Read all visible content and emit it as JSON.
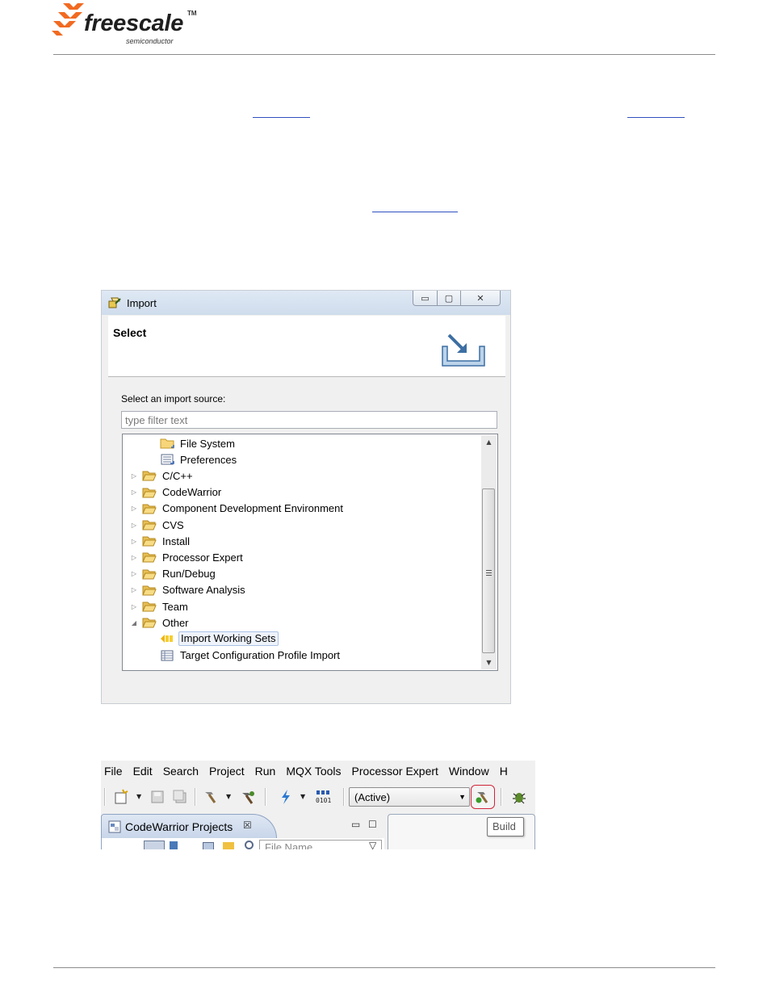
{
  "header": {
    "brand": "freescale",
    "trademark": "TM",
    "subbrand": "semiconductor"
  },
  "colors": {
    "brand_orange": "#f26a21",
    "link_blue": "#3050c0",
    "rule_gray": "#8c8c8c",
    "highlight_red": "#d0243a"
  },
  "import_dialog": {
    "title": "Import",
    "window_buttons": {
      "minimize": "▭",
      "maximize": "▢",
      "close": "✕"
    },
    "banner_title": "Select",
    "source_label": "Select an import source:",
    "filter_placeholder": "type filter text",
    "tree": [
      {
        "label": "File System",
        "icon": "folder-icon",
        "level": 1,
        "expander": ""
      },
      {
        "label": "Preferences",
        "icon": "preferences-icon",
        "level": 1,
        "expander": ""
      },
      {
        "label": "C/C++",
        "icon": "folder-open-icon",
        "level": 0,
        "expander": "▷"
      },
      {
        "label": "CodeWarrior",
        "icon": "folder-open-icon",
        "level": 0,
        "expander": "▷"
      },
      {
        "label": "Component Development Environment",
        "icon": "folder-open-icon",
        "level": 0,
        "expander": "▷"
      },
      {
        "label": "CVS",
        "icon": "folder-open-icon",
        "level": 0,
        "expander": "▷"
      },
      {
        "label": "Install",
        "icon": "folder-open-icon",
        "level": 0,
        "expander": "▷"
      },
      {
        "label": "Processor Expert",
        "icon": "folder-open-icon",
        "level": 0,
        "expander": "▷"
      },
      {
        "label": "Run/Debug",
        "icon": "folder-open-icon",
        "level": 0,
        "expander": "▷"
      },
      {
        "label": "Software Analysis",
        "icon": "folder-open-icon",
        "level": 0,
        "expander": "▷"
      },
      {
        "label": "Team",
        "icon": "folder-open-icon",
        "level": 0,
        "expander": "▷"
      },
      {
        "label": "Other",
        "icon": "folder-open-icon",
        "level": 0,
        "expander": "◢"
      },
      {
        "label": "Import Working Sets",
        "icon": "working-sets-icon",
        "level": 1,
        "expander": "",
        "selected": true
      },
      {
        "label": "Target Configuration Profile Import",
        "icon": "table-icon",
        "level": 1,
        "expander": ""
      }
    ],
    "scroll": {
      "up": "▲",
      "down": "▼"
    }
  },
  "ide": {
    "menu": [
      "File",
      "Edit",
      "Search",
      "Project",
      "Run",
      "MQX Tools",
      "Processor Expert",
      "Window",
      "H"
    ],
    "dropdown_arrow": "▼",
    "build_config": "(Active)",
    "tooltip": "Build",
    "projects_tab": "CodeWarrior Projects",
    "close_glyph": "☒",
    "view_minimize": "▭",
    "view_maximize": "☐",
    "view_menu": "▽",
    "file_name_placeholder": "File Name"
  }
}
